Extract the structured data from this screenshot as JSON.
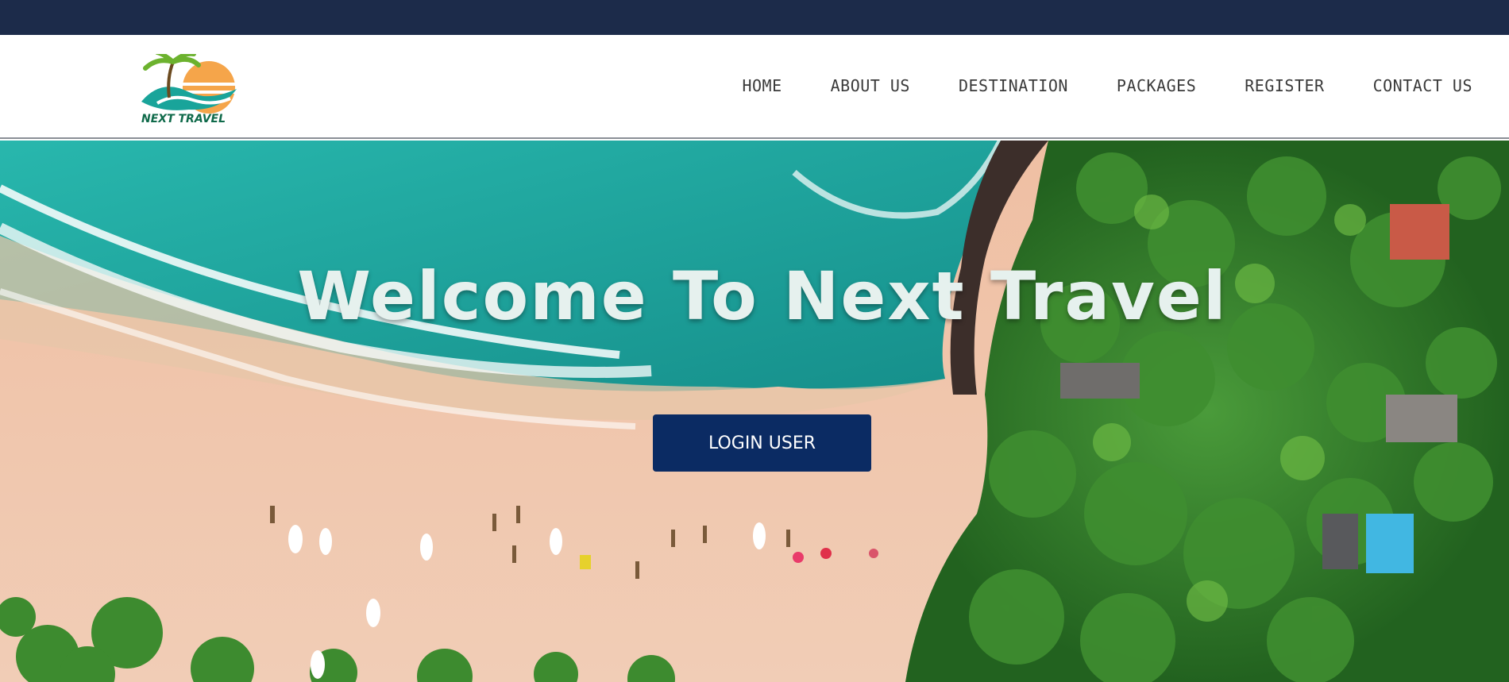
{
  "brand": {
    "logo_text": "NEXT TRAVEL"
  },
  "nav": {
    "items": [
      {
        "label": "HOME"
      },
      {
        "label": "ABOUT US"
      },
      {
        "label": "DESTINATION"
      },
      {
        "label": "PACKAGES"
      },
      {
        "label": "REGISTER"
      },
      {
        "label": "CONTACT US"
      }
    ]
  },
  "hero": {
    "title": "Welcome To Next Travel",
    "login_button": "LOGIN USER"
  },
  "colors": {
    "topbar": "#1c2b4a",
    "button": "#0b2b63",
    "sea": "#1fa79a",
    "sand": "#e9b59a",
    "forest": "#2f7a2c"
  }
}
